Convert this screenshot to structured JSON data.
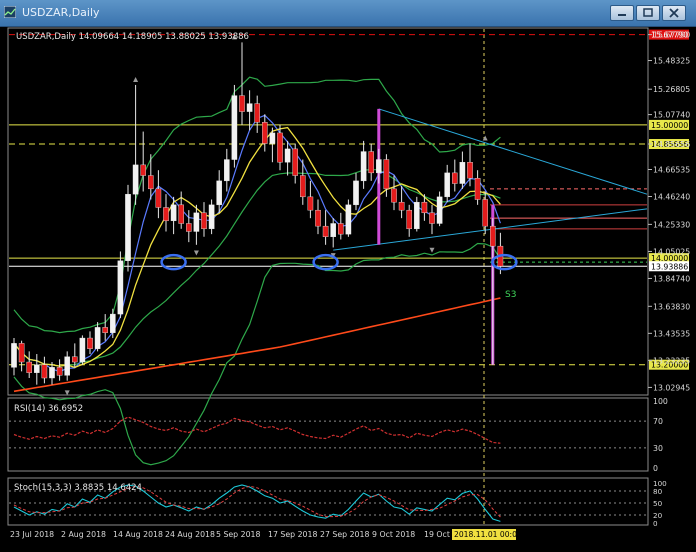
{
  "window": {
    "title": "USDZAR,Daily",
    "buttons": [
      "minimize-button",
      "restore-button",
      "close-button"
    ]
  },
  "chart_data": {
    "type": "candlestick",
    "symbol_info": "USDZAR,Daily  14.09664 14.18905 13.88025 13.93886",
    "price_ticks": [
      "15.67790",
      "15.48325",
      "15.26805",
      "15.07740",
      "14.85656",
      "14.66535",
      "14.46240",
      "14.25330",
      "14.05025",
      "13.84740",
      "13.63830",
      "13.43535",
      "13.23235",
      "13.02945"
    ],
    "price_range": [
      12.98,
      15.72
    ],
    "horizontal_levels": [
      {
        "price": 15.6779,
        "label": "15.67790",
        "color": "#e01010",
        "style": "dashed"
      },
      {
        "price": 15.0,
        "label": "15.00000",
        "color": "#e8e84a",
        "style": "solid"
      },
      {
        "price": 14.85656,
        "label": "14.85656",
        "color": "#e8e84a",
        "style": "dashed"
      },
      {
        "price": 14.0,
        "label": "14.00000",
        "color": "#e8e84a",
        "style": "solid"
      },
      {
        "price": 13.93886,
        "label": "13.93886",
        "color": "#ffffff",
        "style": "solid"
      },
      {
        "price": 13.2,
        "label": "13.20000",
        "color": "#e8e84a",
        "style": "dashed"
      }
    ],
    "annotations": [
      "S3"
    ],
    "date_labels": [
      "23 Jul 2018",
      "2 Aug 2018",
      "14 Aug 2018",
      "24 Aug 2018",
      "5 Sep 2018",
      "17 Sep 2018",
      "27 Sep 2018",
      "9 Oct 2018",
      "19 Oct 2018",
      "2018.11.01 00:00"
    ],
    "candles": [
      [
        13.18,
        13.4,
        13.12,
        13.36
      ],
      [
        13.36,
        13.38,
        13.15,
        13.22
      ],
      [
        13.22,
        13.3,
        13.1,
        13.14
      ],
      [
        13.14,
        13.28,
        13.05,
        13.2
      ],
      [
        13.2,
        13.26,
        13.06,
        13.1
      ],
      [
        13.1,
        13.22,
        13.05,
        13.18
      ],
      [
        13.18,
        13.24,
        13.08,
        13.12
      ],
      [
        13.12,
        13.3,
        13.08,
        13.26
      ],
      [
        13.26,
        13.36,
        13.18,
        13.22
      ],
      [
        13.22,
        13.42,
        13.2,
        13.4
      ],
      [
        13.4,
        13.45,
        13.28,
        13.32
      ],
      [
        13.32,
        13.52,
        13.3,
        13.48
      ],
      [
        13.48,
        13.58,
        13.38,
        13.44
      ],
      [
        13.44,
        13.62,
        13.4,
        13.58
      ],
      [
        13.58,
        14.05,
        13.55,
        13.98
      ],
      [
        13.98,
        14.55,
        13.9,
        14.48
      ],
      [
        14.48,
        15.3,
        14.4,
        14.7
      ],
      [
        14.7,
        14.95,
        14.5,
        14.62
      ],
      [
        14.62,
        14.78,
        14.44,
        14.52
      ],
      [
        14.52,
        14.66,
        14.3,
        14.38
      ],
      [
        14.38,
        14.48,
        14.2,
        14.28
      ],
      [
        14.28,
        14.46,
        14.18,
        14.4
      ],
      [
        14.4,
        14.5,
        14.22,
        14.26
      ],
      [
        14.26,
        14.36,
        14.12,
        14.2
      ],
      [
        14.2,
        14.4,
        14.1,
        14.34
      ],
      [
        14.34,
        14.42,
        14.16,
        14.22
      ],
      [
        14.22,
        14.44,
        14.18,
        14.4
      ],
      [
        14.4,
        14.66,
        14.34,
        14.58
      ],
      [
        14.58,
        14.82,
        14.5,
        14.74
      ],
      [
        14.74,
        15.3,
        14.68,
        15.22
      ],
      [
        15.22,
        15.62,
        15.0,
        15.1
      ],
      [
        15.1,
        15.26,
        14.96,
        15.16
      ],
      [
        15.16,
        15.22,
        14.94,
        15.02
      ],
      [
        15.02,
        15.08,
        14.8,
        14.86
      ],
      [
        14.86,
        14.98,
        14.72,
        14.94
      ],
      [
        14.94,
        15.0,
        14.66,
        14.72
      ],
      [
        14.72,
        14.88,
        14.62,
        14.82
      ],
      [
        14.82,
        14.86,
        14.56,
        14.62
      ],
      [
        14.62,
        14.74,
        14.4,
        14.46
      ],
      [
        14.46,
        14.58,
        14.3,
        14.36
      ],
      [
        14.36,
        14.44,
        14.18,
        14.24
      ],
      [
        14.24,
        14.36,
        14.1,
        14.16
      ],
      [
        14.16,
        14.3,
        14.08,
        14.26
      ],
      [
        14.26,
        14.34,
        14.14,
        14.18
      ],
      [
        14.18,
        14.44,
        14.16,
        14.4
      ],
      [
        14.4,
        14.64,
        14.36,
        14.58
      ],
      [
        14.58,
        14.88,
        14.52,
        14.8
      ],
      [
        14.8,
        14.86,
        14.58,
        14.64
      ],
      [
        14.64,
        14.82,
        14.56,
        14.74
      ],
      [
        14.74,
        14.78,
        14.46,
        14.52
      ],
      [
        14.52,
        14.62,
        14.36,
        14.42
      ],
      [
        14.42,
        14.54,
        14.3,
        14.36
      ],
      [
        14.36,
        14.4,
        14.16,
        14.22
      ],
      [
        14.22,
        14.46,
        14.2,
        14.42
      ],
      [
        14.42,
        14.48,
        14.28,
        14.34
      ],
      [
        14.34,
        14.4,
        14.18,
        14.26
      ],
      [
        14.26,
        14.5,
        14.24,
        14.46
      ],
      [
        14.46,
        14.7,
        14.42,
        14.64
      ],
      [
        14.64,
        14.74,
        14.5,
        14.56
      ],
      [
        14.56,
        14.8,
        14.52,
        14.72
      ],
      [
        14.72,
        14.86,
        14.54,
        14.6
      ],
      [
        14.6,
        14.66,
        14.4,
        14.44
      ],
      [
        14.44,
        14.5,
        14.18,
        14.24
      ],
      [
        14.24,
        14.3,
        13.2,
        14.09
      ],
      [
        14.09,
        14.19,
        13.88,
        13.94
      ]
    ],
    "indicators": [
      {
        "name": "RSI(14)",
        "value": "36.6952",
        "ticks": [
          "100",
          "70",
          "30",
          "0"
        ],
        "values": [
          50,
          46,
          43,
          47,
          44,
          48,
          46,
          52,
          49,
          55,
          51,
          57,
          53,
          59,
          70,
          76,
          72,
          68,
          62,
          58,
          56,
          60,
          55,
          53,
          58,
          54,
          59,
          64,
          67,
          74,
          71,
          69,
          64,
          60,
          62,
          57,
          60,
          55,
          50,
          47,
          45,
          44,
          49,
          46,
          52,
          58,
          63,
          56,
          59,
          52,
          49,
          50,
          45,
          52,
          49,
          47,
          53,
          57,
          54,
          58,
          55,
          50,
          44,
          38,
          37
        ]
      },
      {
        "name": "Stoch(15,3,3)",
        "value": "3.8835 14.6424",
        "ticks": [
          "100",
          "80",
          "50",
          "20",
          "0"
        ],
        "k": [
          40,
          30,
          20,
          28,
          22,
          34,
          30,
          48,
          40,
          60,
          52,
          70,
          62,
          78,
          90,
          95,
          92,
          80,
          65,
          50,
          40,
          45,
          38,
          30,
          40,
          34,
          46,
          62,
          75,
          90,
          95,
          90,
          80,
          68,
          62,
          50,
          55,
          42,
          30,
          20,
          15,
          12,
          22,
          18,
          34,
          55,
          75,
          65,
          72,
          55,
          40,
          36,
          22,
          38,
          34,
          30,
          46,
          62,
          58,
          74,
          80,
          60,
          34,
          10,
          4
        ],
        "d": [
          45,
          36,
          28,
          26,
          26,
          28,
          30,
          38,
          40,
          50,
          52,
          60,
          62,
          70,
          78,
          87,
          92,
          88,
          78,
          65,
          52,
          45,
          42,
          36,
          36,
          35,
          40,
          48,
          60,
          75,
          86,
          92,
          88,
          80,
          70,
          60,
          56,
          50,
          42,
          32,
          22,
          16,
          16,
          17,
          25,
          36,
          54,
          65,
          71,
          64,
          55,
          44,
          33,
          32,
          31,
          34,
          37,
          46,
          55,
          65,
          71,
          71,
          58,
          35,
          15
        ]
      }
    ]
  }
}
